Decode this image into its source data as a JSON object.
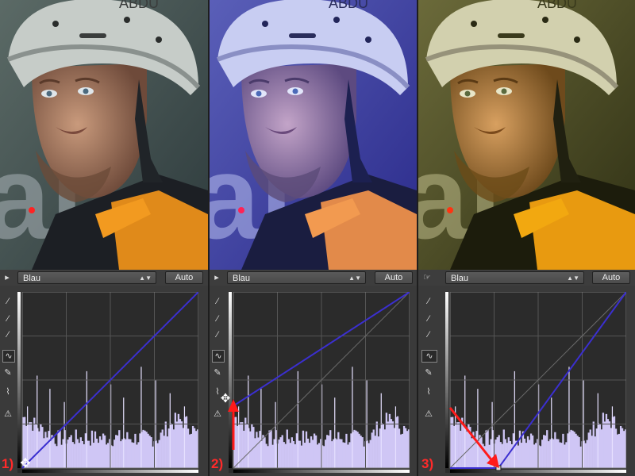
{
  "panels": [
    {
      "id": "p1",
      "channel": "Blau",
      "auto_label": "Auto",
      "step": "1)",
      "tint": "neutral"
    },
    {
      "id": "p2",
      "channel": "Blau",
      "auto_label": "Auto",
      "step": "2)",
      "tint": "blue"
    },
    {
      "id": "p3",
      "channel": "Blau",
      "auto_label": "Auto",
      "step": "3)",
      "tint": "yellow"
    }
  ],
  "photo": {
    "helmet_text": "ABDU",
    "background_letters": "aı"
  },
  "colors": {
    "curve": "#3b2fd0",
    "histogram": "#cfc6f5",
    "annotation": "#ff1a1a",
    "panel_bg": "#3a3a3a"
  },
  "curves": {
    "p1": {
      "points": [
        [
          0,
          0
        ],
        [
          255,
          255
        ]
      ]
    },
    "p2": {
      "points": [
        [
          0,
          90
        ],
        [
          255,
          255
        ]
      ]
    },
    "p3": {
      "points": [
        [
          0,
          0
        ],
        [
          70,
          0
        ],
        [
          255,
          255
        ]
      ]
    }
  },
  "icons": [
    "point-tool-icon",
    "eyedropper-black-icon",
    "eyedropper-gray-icon",
    "eyedropper-white-icon",
    "curve-tool-icon",
    "pencil-tool-icon",
    "smooth-tool-icon",
    "clipping-warning-icon"
  ]
}
